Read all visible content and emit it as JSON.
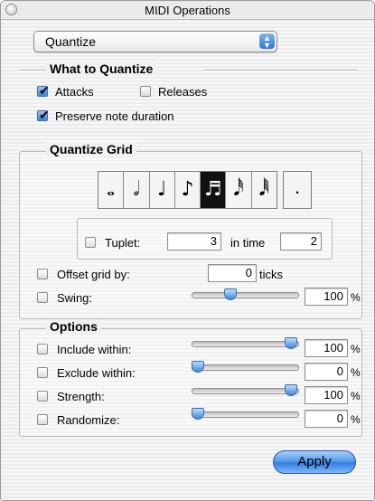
{
  "window": {
    "title": "MIDI Operations"
  },
  "operation": {
    "selected": "Quantize"
  },
  "what_to_quantize": {
    "title": "What to Quantize",
    "attacks": {
      "label": "Attacks",
      "checked": true
    },
    "releases": {
      "label": "Releases",
      "checked": false
    },
    "preserve": {
      "label": "Preserve note duration",
      "checked": true
    }
  },
  "grid": {
    "title": "Quantize Grid",
    "notes": [
      {
        "name": "whole-note",
        "glyph": "𝅝",
        "selected": false
      },
      {
        "name": "half-note",
        "glyph": "𝅗𝅥",
        "selected": false
      },
      {
        "name": "quarter-note",
        "glyph": "♩",
        "selected": false
      },
      {
        "name": "eighth-note",
        "glyph": "♪",
        "selected": false
      },
      {
        "name": "sixteenth-note",
        "glyph": "♬",
        "selected": true
      },
      {
        "name": "thirty-second-note",
        "glyph": "𝅘𝅥𝅰",
        "selected": false
      },
      {
        "name": "sixty-fourth-note",
        "glyph": "𝅘𝅥𝅱",
        "selected": false
      }
    ],
    "dot_glyph": ".",
    "tuplet": {
      "label": "Tuplet:",
      "checked": false,
      "value": "3",
      "in_time_label": "in time",
      "in_time_value": "2"
    },
    "offset": {
      "label": "Offset grid by:",
      "checked": false,
      "value": "0",
      "unit": "ticks"
    },
    "swing": {
      "label": "Swing:",
      "checked": false,
      "value": "100",
      "unit": "%",
      "slider_level": 0.35
    }
  },
  "options": {
    "title": "Options",
    "include": {
      "label": "Include within:",
      "checked": false,
      "value": "100",
      "unit": "%",
      "slider_level": 1.0
    },
    "exclude": {
      "label": "Exclude within:",
      "checked": false,
      "value": "0",
      "unit": "%",
      "slider_level": 0.0
    },
    "strength": {
      "label": "Strength:",
      "checked": false,
      "value": "100",
      "unit": "%",
      "slider_level": 1.0
    },
    "randomize": {
      "label": "Randomize:",
      "checked": false,
      "value": "0",
      "unit": "%",
      "slider_level": 0.0
    }
  },
  "apply_button": {
    "label": "Apply"
  },
  "colors": {
    "accent": "#3f86d8",
    "window_bg": "#ececec"
  }
}
